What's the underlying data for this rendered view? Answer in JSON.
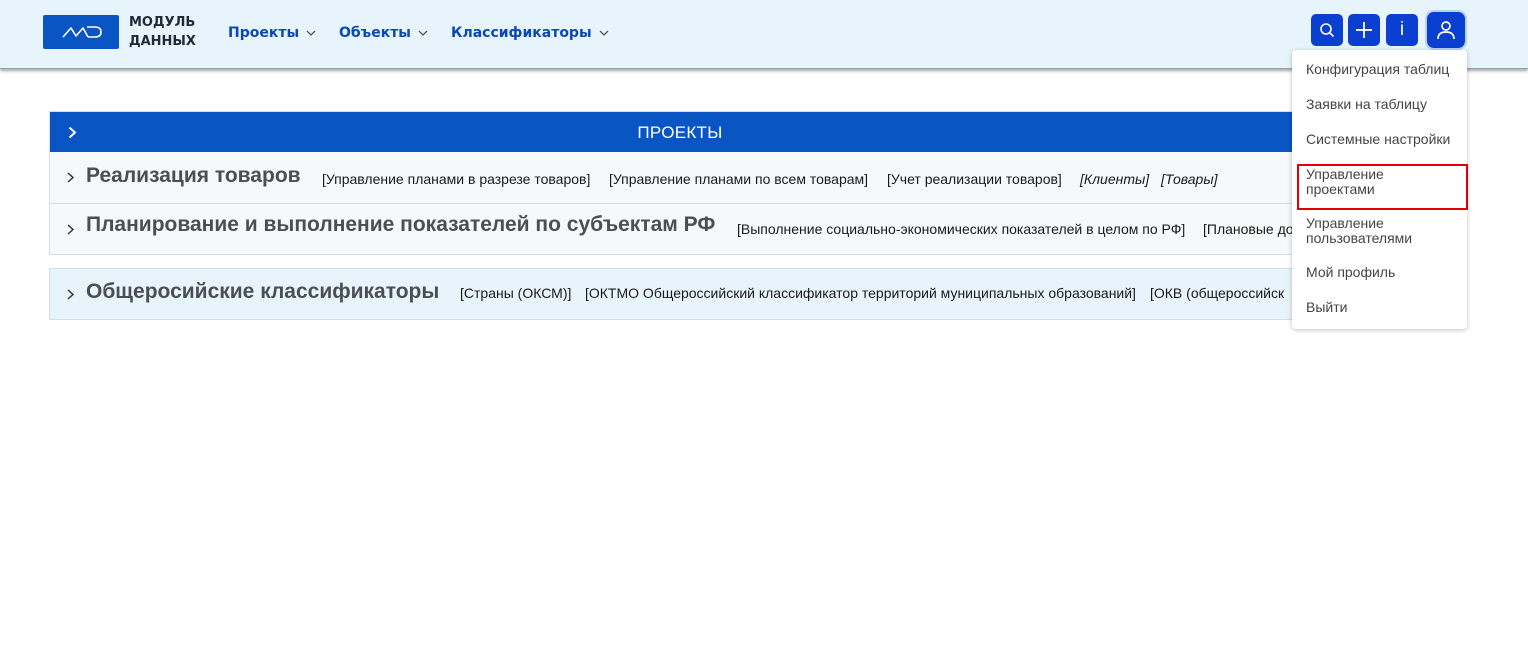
{
  "header": {
    "logo_line1": "МОДУЛЬ",
    "logo_line2": "ДАННЫХ",
    "nav": [
      "Проекты",
      "Объекты",
      "Классификаторы"
    ],
    "info_label": "i"
  },
  "user_menu": {
    "items": [
      "Конфигурация таблиц",
      "Заявки на таблицу",
      "Системные настройки",
      "Управление",
      "проектами",
      "Управление",
      "пользователями",
      "Мой профиль",
      "Выйти"
    ]
  },
  "projects_panel": {
    "title": "ПРОЕКТЫ",
    "rows": [
      {
        "title": "Реализация товаров",
        "links": [
          "[Управление планами в разрезе товаров]",
          "[Управление планами по всем товарам]",
          "[Учет реализации товаров]",
          "[Клиенты]",
          "[Товары]"
        ]
      },
      {
        "title": "Планирование и выполнение показателей по субъектам РФ",
        "links": [
          "[Выполнение социально-экономических показателей в целом по РФ]",
          "[Плановые до"
        ]
      }
    ]
  },
  "classifiers_panel": {
    "title": "Общеросийские классификаторы",
    "links": [
      "[Страны (ОКСМ)]",
      "[ОКТМО Общероссийский классификатор территорий муниципальных образований]",
      "[ОКВ (общероссийск"
    ]
  },
  "colors": {
    "primary": "#0a55c4",
    "header_bg": "#e7f4fc",
    "highlight": "#e00000"
  }
}
